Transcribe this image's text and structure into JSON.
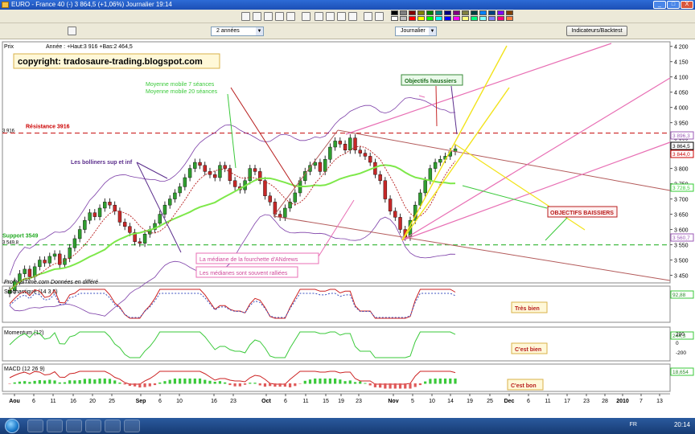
{
  "window": {
    "title": "EURO - France 40 (-)   3 864,5 (+1,06%)   Journalier  19:14",
    "buttons": [
      "_",
      "□",
      "X"
    ]
  },
  "toolbar": {
    "period_select": "2 années",
    "interval_select": "Journalier",
    "indicator_button": "Indicateurs/Backtest",
    "color_swatches": [
      "#000000",
      "#808080",
      "#800000",
      "#808000",
      "#008000",
      "#008080",
      "#000080",
      "#800080",
      "#808040",
      "#004040",
      "#0080ff",
      "#004080",
      "#8000ff",
      "#804000",
      "#ffffff",
      "#c0c0c0",
      "#ff0000",
      "#ffff00",
      "#00ff00",
      "#00ffff",
      "#0000ff",
      "#ff00ff",
      "#ffff80",
      "#00ff80",
      "#80ffff",
      "#8080ff",
      "#ff0080",
      "#ff8040"
    ]
  },
  "price_panel": {
    "label": "Prix",
    "header": "Année : +Haut:3 916 +Bas:2 464,5",
    "copyright": "copyright: tradosaure-trading.blogspot.com",
    "source": "ProRealTime.com  Données en différé",
    "resistance_label": "Résistance 3916",
    "resistance_value": "3 916",
    "support_label": "Support 3549",
    "support_value": "3 549,8",
    "annotations": {
      "ma": "Moyenne mobile 7 séances\nMoyenne mobile 20 séances",
      "boll": "Les bolliners sup et inf",
      "obj_up": "Objectifs haussiers",
      "obj_down": "OBJECTIFS BAISSIERS",
      "median1": "La médiane de la fourchette d'ANdrews",
      "median2": "Les médianes sont souvent ralliées"
    },
    "y_axis": [
      "4 200",
      "4 150",
      "4 100",
      "4 050",
      "4 000",
      "3 950",
      "3 900",
      "3 850",
      "3 800",
      "3 750",
      "3 700",
      "3 650",
      "3 600",
      "3 550",
      "3 500",
      "3 450"
    ],
    "y_range": [
      3425,
      4215
    ],
    "price_tags": [
      {
        "value": "3 896,3",
        "color": "#9b59b6"
      },
      {
        "value": "3 864,5",
        "color": "#000000"
      },
      {
        "value": "3 844,0",
        "color": "#cc0000"
      },
      {
        "value": "3 728,5",
        "color": "#33cc33"
      },
      {
        "value": "3 560,7",
        "color": "#9b59b6"
      }
    ]
  },
  "stochastic": {
    "label": "Stochastique (14 3 5)",
    "comment": "Très bien",
    "value_tag": "92,88"
  },
  "momentum": {
    "label": "Momentum (12)",
    "comment": "C'est bien",
    "value_tag": "244,3",
    "axis": [
      "200",
      "0",
      "-200"
    ]
  },
  "macd": {
    "label": "MACD (12 26 9)",
    "comment": "C'est bon",
    "value_tag": "18,654"
  },
  "x_axis": [
    {
      "label": "Aou",
      "x": 18
    },
    {
      "label": "6",
      "x": 42
    },
    {
      "label": "11",
      "x": 66
    },
    {
      "label": "16",
      "x": 91
    },
    {
      "label": "20",
      "x": 115
    },
    {
      "label": "25",
      "x": 139
    },
    {
      "label": "Sep",
      "x": 175
    },
    {
      "label": "6",
      "x": 199
    },
    {
      "label": "10",
      "x": 223
    },
    {
      "label": "16",
      "x": 266
    },
    {
      "label": "23",
      "x": 290
    },
    {
      "label": "Oct",
      "x": 331
    },
    {
      "label": "6",
      "x": 355
    },
    {
      "label": "11",
      "x": 380
    },
    {
      "label": "15",
      "x": 405
    },
    {
      "label": "19",
      "x": 424
    },
    {
      "label": "23",
      "x": 446
    },
    {
      "label": "Nov",
      "x": 489
    },
    {
      "label": "5",
      "x": 513
    },
    {
      "label": "10",
      "x": 537
    },
    {
      "label": "14",
      "x": 560
    },
    {
      "label": "19",
      "x": 584
    },
    {
      "label": "25",
      "x": 609
    },
    {
      "label": "Dec",
      "x": 633
    },
    {
      "label": "6",
      "x": 657
    },
    {
      "label": "11",
      "x": 681
    },
    {
      "label": "17",
      "x": 705
    },
    {
      "label": "23",
      "x": 729
    },
    {
      "label": "28",
      "x": 752
    },
    {
      "label": "2010",
      "x": 774
    },
    {
      "label": "7",
      "x": 797
    },
    {
      "label": "13",
      "x": 820
    }
  ],
  "taskbar": {
    "clock": "20:14",
    "lang": "FR"
  },
  "chart_data": {
    "type": "candlestick",
    "note_series": "EURO - France 40 daily",
    "candles_close": [
      3400,
      3430,
      3455,
      3470,
      3445,
      3478,
      3500,
      3490,
      3512,
      3520,
      3485,
      3505,
      3540,
      3570,
      3600,
      3630,
      3655,
      3642,
      3670,
      3690,
      3680,
      3660,
      3624,
      3610,
      3590,
      3560,
      3555,
      3585,
      3600,
      3620,
      3650,
      3680,
      3700,
      3720,
      3740,
      3770,
      3800,
      3820,
      3810,
      3790,
      3780,
      3770,
      3810,
      3800,
      3760,
      3740,
      3730,
      3760,
      3800,
      3790,
      3760,
      3710,
      3690,
      3650,
      3640,
      3670,
      3690,
      3720,
      3760,
      3790,
      3810,
      3820,
      3790,
      3830,
      3870,
      3890,
      3880,
      3860,
      3900,
      3860,
      3850,
      3840,
      3820,
      3780,
      3760,
      3700,
      3660,
      3640,
      3600,
      3575,
      3630,
      3680,
      3720,
      3760,
      3800,
      3820,
      3830,
      3840,
      3855,
      3864.5
    ],
    "ylim": [
      3425,
      4215
    ]
  }
}
